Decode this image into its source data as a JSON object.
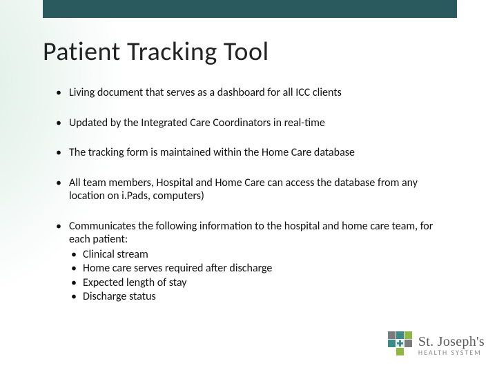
{
  "title": "Patient Tracking Tool",
  "bullets": [
    "Living document that serves as a dashboard for all ICC clients",
    "Updated by the Integrated Care Coordinators in real-time",
    "The tracking form  is maintained within the Home Care database",
    "All team members, Hospital and Home Care can access the database from any location on i.Pads, computers)",
    "Communicates the following information to the hospital and home care team, for each patient:"
  ],
  "subbullets": [
    "Clinical stream",
    "Home care serves required after discharge",
    "Expected length of stay",
    "Discharge status"
  ],
  "logo": {
    "name": "St. Joseph's",
    "sub": "HEALTH SYSTEM"
  },
  "colors": {
    "topbar": "#2a5a5e",
    "logo_teal": "#3a8a88",
    "logo_green": "#8fb843",
    "logo_gray": "#7b7b7b"
  }
}
